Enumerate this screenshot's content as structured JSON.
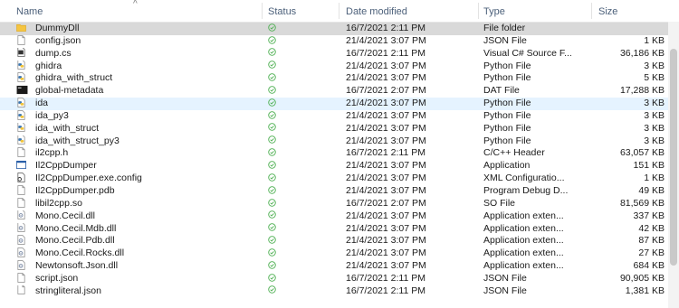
{
  "columns": {
    "name": "Name",
    "status": "Status",
    "date": "Date modified",
    "type": "Type",
    "size": "Size"
  },
  "files": [
    {
      "name": "DummyDll",
      "date": "16/7/2021 2:11 PM",
      "type": "File folder",
      "size": "",
      "icon": "folder-icon",
      "state": "selected"
    },
    {
      "name": "config.json",
      "date": "21/4/2021 3:07 PM",
      "type": "JSON File",
      "size": "1 KB",
      "icon": "file-icon"
    },
    {
      "name": "dump.cs",
      "date": "16/7/2021 2:11 PM",
      "type": "Visual C# Source F...",
      "size": "36,186 KB",
      "icon": "csharp-file-icon"
    },
    {
      "name": "ghidra",
      "date": "21/4/2021 3:07 PM",
      "type": "Python File",
      "size": "3 KB",
      "icon": "python-file-icon"
    },
    {
      "name": "ghidra_with_struct",
      "date": "21/4/2021 3:07 PM",
      "type": "Python File",
      "size": "5 KB",
      "icon": "python-file-icon"
    },
    {
      "name": "global-metadata",
      "date": "16/7/2021 2:07 PM",
      "type": "DAT File",
      "size": "17,288 KB",
      "icon": "dat-file-icon"
    },
    {
      "name": "ida",
      "date": "21/4/2021 3:07 PM",
      "type": "Python File",
      "size": "3 KB",
      "icon": "python-file-icon",
      "state": "hover"
    },
    {
      "name": "ida_py3",
      "date": "21/4/2021 3:07 PM",
      "type": "Python File",
      "size": "3 KB",
      "icon": "python-file-icon"
    },
    {
      "name": "ida_with_struct",
      "date": "21/4/2021 3:07 PM",
      "type": "Python File",
      "size": "3 KB",
      "icon": "python-file-icon"
    },
    {
      "name": "ida_with_struct_py3",
      "date": "21/4/2021 3:07 PM",
      "type": "Python File",
      "size": "3 KB",
      "icon": "python-file-icon"
    },
    {
      "name": "il2cpp.h",
      "date": "16/7/2021 2:11 PM",
      "type": "C/C++ Header",
      "size": "63,057 KB",
      "icon": "file-icon"
    },
    {
      "name": "Il2CppDumper",
      "date": "21/4/2021 3:07 PM",
      "type": "Application",
      "size": "151 KB",
      "icon": "application-icon"
    },
    {
      "name": "Il2CppDumper.exe.config",
      "date": "21/4/2021 3:07 PM",
      "type": "XML Configuratio...",
      "size": "1 KB",
      "icon": "config-file-icon"
    },
    {
      "name": "Il2CppDumper.pdb",
      "date": "21/4/2021 3:07 PM",
      "type": "Program Debug D...",
      "size": "49 KB",
      "icon": "file-icon"
    },
    {
      "name": "libil2cpp.so",
      "date": "16/7/2021 2:07 PM",
      "type": "SO File",
      "size": "81,569 KB",
      "icon": "file-icon"
    },
    {
      "name": "Mono.Cecil.dll",
      "date": "21/4/2021 3:07 PM",
      "type": "Application exten...",
      "size": "337 KB",
      "icon": "dll-file-icon"
    },
    {
      "name": "Mono.Cecil.Mdb.dll",
      "date": "21/4/2021 3:07 PM",
      "type": "Application exten...",
      "size": "42 KB",
      "icon": "dll-file-icon"
    },
    {
      "name": "Mono.Cecil.Pdb.dll",
      "date": "21/4/2021 3:07 PM",
      "type": "Application exten...",
      "size": "87 KB",
      "icon": "dll-file-icon"
    },
    {
      "name": "Mono.Cecil.Rocks.dll",
      "date": "21/4/2021 3:07 PM",
      "type": "Application exten...",
      "size": "27 KB",
      "icon": "dll-file-icon"
    },
    {
      "name": "Newtonsoft.Json.dll",
      "date": "21/4/2021 3:07 PM",
      "type": "Application exten...",
      "size": "684 KB",
      "icon": "dll-file-icon"
    },
    {
      "name": "script.json",
      "date": "16/7/2021 2:11 PM",
      "type": "JSON File",
      "size": "90,905 KB",
      "icon": "file-icon"
    },
    {
      "name": "stringliteral.json",
      "date": "16/7/2021 2:11 PM",
      "type": "JSON File",
      "size": "1,381 KB",
      "icon": "file-icon"
    }
  ],
  "colors": {
    "selected": "#d9d9d9",
    "hover": "#e5f3ff",
    "status_ok": "#4caf50",
    "folder": "#f5c542"
  }
}
